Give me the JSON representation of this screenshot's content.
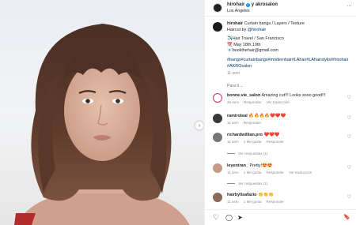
{
  "post": {
    "author": "hirohair",
    "collaborator": "akrosalon",
    "author_line": "hirohair · y akrosalon",
    "location": "Los Ángeles"
  },
  "caption": {
    "username": "hirohair",
    "line1": "Curtain bangs / Layers / Texture",
    "line2_prefix": "Haircut by ",
    "line2_mention": "@hirohair",
    "line3": "✈️Hair Travel / San Francisco",
    "line4": "📆 May 18th,19th",
    "line5": "📧bookthehair@gmail.com",
    "hashtags": "#bangs#curtainbangs#modernhair#LAhair#LAhairstylist#hirohair #AKROsalon",
    "time": "11 sem"
  },
  "para_ti": "Para ti",
  "comments": [
    {
      "username": "bonne.vie_salon",
      "text": "Amazing cut!!! Looks sooo good!!!",
      "time": "26 sem",
      "likes": "",
      "reply": "Responder",
      "translate": "Ver traducción",
      "replies": ""
    },
    {
      "username": "ramiroleal",
      "text": "🔥🔥🔥🔥❤️❤️❤️",
      "time": "11 sem",
      "likes": "",
      "reply": "Responder",
      "translate": "",
      "replies": ""
    },
    {
      "username": "richardwillian.pro",
      "text": "❤️❤️❤️",
      "time": "11 sem",
      "likes": "1 Me gusta",
      "reply": "Responder",
      "translate": "",
      "replies": "Ver respuestas (1)"
    },
    {
      "username": "leyentran_",
      "text": "Pretty!😍😍",
      "time": "11 sem",
      "likes": "1 Me gusta",
      "reply": "Responder",
      "translate": "Ver traducción",
      "replies": "Ver respuestas (1)"
    },
    {
      "username": "hairbylisafazio",
      "text": "👏👏👏",
      "time": "11 sem",
      "likes": "1 Me gusta",
      "reply": "Responder",
      "translate": "",
      "replies": ""
    }
  ],
  "icons": {
    "heart": "♡",
    "comment": "◯",
    "share": "➤",
    "save": "🔖",
    "more": "···",
    "next": "›"
  },
  "colors": {
    "link": "#00376b",
    "verified": "#0095f6",
    "muted": "#8e8e8e"
  }
}
